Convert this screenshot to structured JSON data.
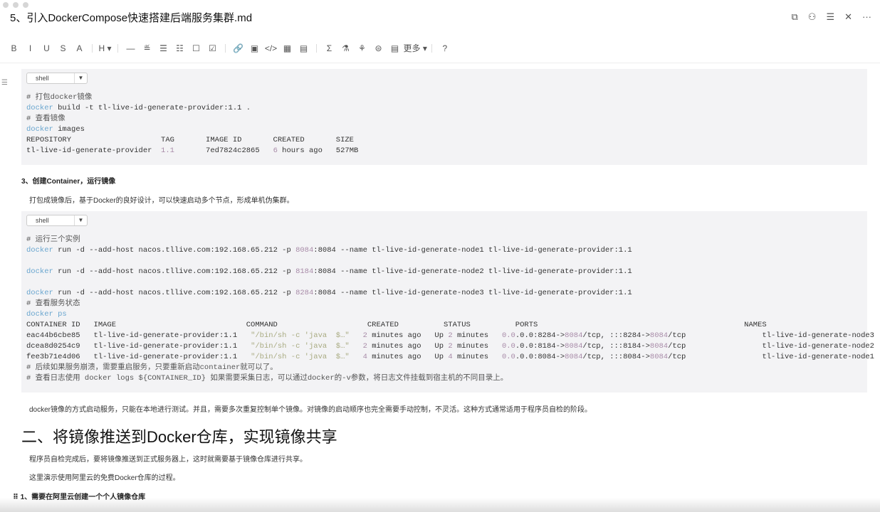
{
  "window": {
    "title": "5、引入DockerCompose快速搭建后端服务集群.md"
  },
  "top_icons": [
    "⧉",
    "⚇",
    "☰",
    "✕",
    "···"
  ],
  "toolbar": [
    "B",
    "I",
    "U",
    "S",
    "A",
    "|",
    "H ▾",
    "|",
    "—",
    "≝",
    "☰",
    "☷",
    "☐",
    "☑",
    "|",
    "🔗",
    "▣",
    "</>",
    "▦",
    "▤",
    "|",
    "Σ",
    "⚗",
    "⚘",
    "⊜",
    "▤",
    "更多 ▾",
    "|",
    "?"
  ],
  "block1": {
    "lang": "shell",
    "lines": [
      [
        [
          "# 打包docker镜像",
          "cm"
        ]
      ],
      [
        [
          "docker",
          "kw"
        ],
        [
          " build -t tl-live-id-generate-provider:1.1 .",
          ""
        ]
      ],
      [
        [
          "# 查看镜像",
          "cm"
        ]
      ],
      [
        [
          "docker",
          "kw"
        ],
        [
          " images",
          ""
        ]
      ],
      [
        [
          "REPOSITORY                    TAG       IMAGE ID       CREATED       SIZE",
          ""
        ]
      ],
      [
        [
          "tl-live-id-generate-provider  ",
          ""
        ],
        [
          "1.1",
          "num"
        ],
        [
          "       7ed7824c2865   ",
          ""
        ],
        [
          "6",
          "num"
        ],
        [
          " hours ago   527MB",
          ""
        ]
      ]
    ]
  },
  "heading3": "3、创建Container，运行镜像",
  "para1": "打包成镜像后，基于Docker的良好设计，可以快速启动多个节点，形成单机伪集群。",
  "block2": {
    "lang": "shell",
    "lines": [
      [
        [
          "# 运行三个实例",
          "cm"
        ]
      ],
      [
        [
          "docker",
          "kw"
        ],
        [
          " run -d --add-host nacos.tllive.com:192.168.65.212 -p ",
          ""
        ],
        [
          "8084",
          "num"
        ],
        [
          ":8084 --name tl-live-id-generate-node1 tl-live-id-generate-provider:1.1",
          ""
        ]
      ],
      [
        [
          "",
          ""
        ]
      ],
      [
        [
          "docker",
          "kw"
        ],
        [
          " run -d --add-host nacos.tllive.com:192.168.65.212 -p ",
          ""
        ],
        [
          "8184",
          "num"
        ],
        [
          ":8084 --name tl-live-id-generate-node2 tl-live-id-generate-provider:1.1",
          ""
        ]
      ],
      [
        [
          "",
          ""
        ]
      ],
      [
        [
          "docker",
          "kw"
        ],
        [
          " run -d --add-host nacos.tllive.com:192.168.65.212 -p ",
          ""
        ],
        [
          "8284",
          "num"
        ],
        [
          ":8084 --name tl-live-id-generate-node3 tl-live-id-generate-provider:1.1",
          ""
        ]
      ],
      [
        [
          "# 查看服务状态",
          "cm"
        ]
      ],
      [
        [
          "docker ps",
          "kw"
        ]
      ],
      [
        [
          "CONTAINER ID   IMAGE                             COMMAND                    CREATED          STATUS          PORTS                                              NAMES",
          ""
        ]
      ],
      [
        [
          "eac44b6cbe85   tl-live-id-generate-provider:1.1   ",
          ""
        ],
        [
          "\"/bin/sh -c 'java  $…\"",
          "str"
        ],
        [
          "   ",
          ""
        ],
        [
          "2",
          "num"
        ],
        [
          " minutes ago   Up ",
          ""
        ],
        [
          "2",
          "num"
        ],
        [
          " minutes   ",
          ""
        ],
        [
          "0.0",
          "num"
        ],
        [
          ".0.0:8284->",
          ""
        ],
        [
          "8084",
          "num"
        ],
        [
          "/tcp, :::8284->",
          ""
        ],
        [
          "8084",
          "num"
        ],
        [
          "/tcp                 tl-live-id-generate-node3",
          ""
        ]
      ],
      [
        [
          "dcea8d0254c9   tl-live-id-generate-provider:1.1   ",
          ""
        ],
        [
          "\"/bin/sh -c 'java  $…\"",
          "str"
        ],
        [
          "   ",
          ""
        ],
        [
          "2",
          "num"
        ],
        [
          " minutes ago   Up ",
          ""
        ],
        [
          "2",
          "num"
        ],
        [
          " minutes   ",
          ""
        ],
        [
          "0.0",
          "num"
        ],
        [
          ".0.0:8184->",
          ""
        ],
        [
          "8084",
          "num"
        ],
        [
          "/tcp, :::8184->",
          ""
        ],
        [
          "8084",
          "num"
        ],
        [
          "/tcp                 tl-live-id-generate-node2",
          ""
        ]
      ],
      [
        [
          "fee3b71e4d06   tl-live-id-generate-provider:1.1   ",
          ""
        ],
        [
          "\"/bin/sh -c 'java  $…\"",
          "str"
        ],
        [
          "   ",
          ""
        ],
        [
          "4",
          "num"
        ],
        [
          " minutes ago   Up ",
          ""
        ],
        [
          "4",
          "num"
        ],
        [
          " minutes   ",
          ""
        ],
        [
          "0.0",
          "num"
        ],
        [
          ".0.0:8084->",
          ""
        ],
        [
          "8084",
          "num"
        ],
        [
          "/tcp, :::8084->",
          ""
        ],
        [
          "8084",
          "num"
        ],
        [
          "/tcp                 tl-live-id-generate-node1",
          ""
        ]
      ],
      [
        [
          "# 后续如果服务崩溃，需要重启服务，只要重新启动container就可以了。",
          "cm"
        ]
      ],
      [
        [
          "# 查看日志使用 docker logs ${CONTAINER_ID} 如果需要采集日志，可以通过docker的-v参数，将日志文件挂载到宿主机的不同目录上。",
          "cm"
        ]
      ]
    ]
  },
  "para2": "docker镜像的方式启动服务，只能在本地进行测试。并且，需要多次重复控制单个镜像。对镜像的启动顺序也完全需要手动控制，不灵活。这种方式通常适用于程序员自检的阶段。",
  "heading2": "二、将镜像推送到Docker仓库，实现镜像共享",
  "para3": "程序员自检完成后，要将镜像推送到正式服务器上，这时就需要基于镜像仓库进行共享。",
  "para4": "这里演示使用阿里云的免费Docker仓库的过程。",
  "heading3b": "1、需要在阿里云创建一个个人镜像仓库",
  "colors": {
    "keyword": "#6aa6cf",
    "number": "#a88ba8",
    "string": "#a9ab82",
    "code_bg": "#f3f3f5"
  }
}
